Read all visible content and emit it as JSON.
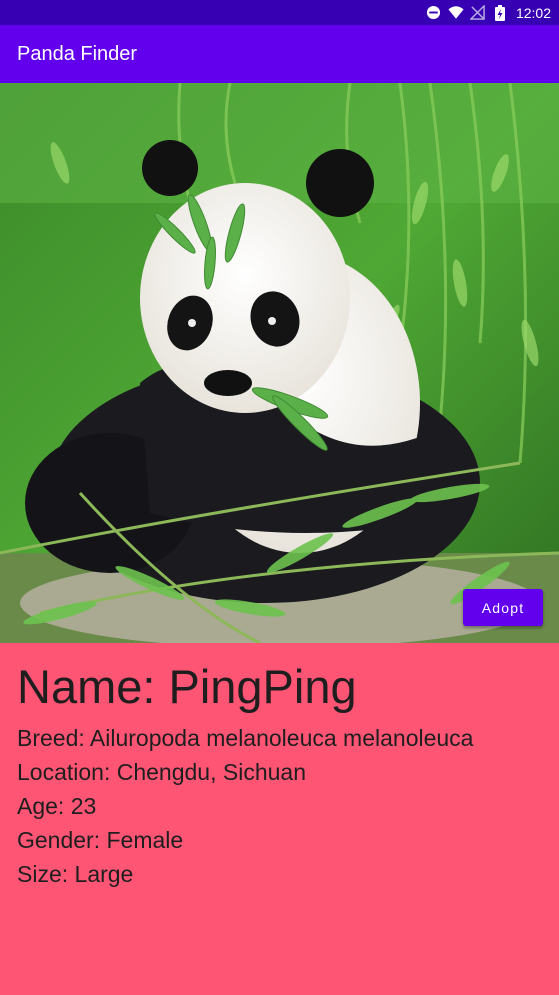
{
  "status_bar": {
    "time": "12:02",
    "icons": [
      "do-not-disturb-icon",
      "wifi-icon",
      "no-signal-icon",
      "battery-charging-icon"
    ]
  },
  "app_bar": {
    "title": "Panda Finder"
  },
  "hero": {
    "image": "giant-panda-eating-bamboo-photo",
    "adopt_label": "Adopt"
  },
  "panda": {
    "name": "Name: PingPing",
    "breed": "Breed: Ailuropoda melanoleuca melanoleuca",
    "location": "Location: Chengdu, Sichuan",
    "age": "Age: 23",
    "gender": "Gender: Female",
    "size": "Size: Large"
  },
  "colors": {
    "status_bar": "#3700b3",
    "primary": "#6200ee",
    "info_background": "#ff5575"
  }
}
